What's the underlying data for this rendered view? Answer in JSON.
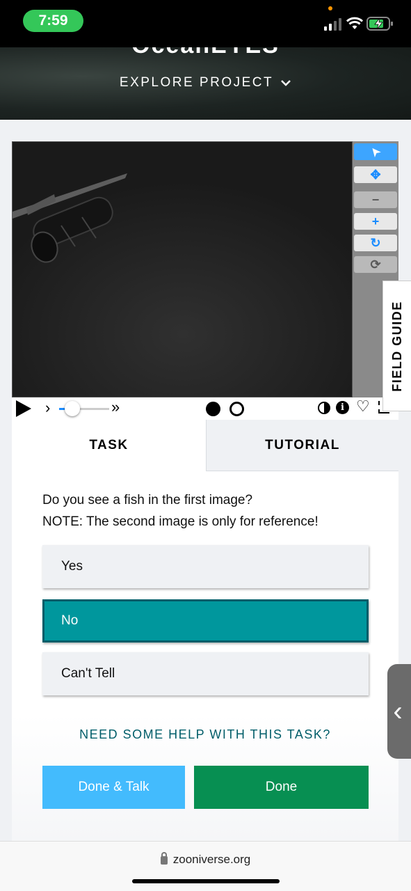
{
  "status_bar": {
    "time": "7:59"
  },
  "hero": {
    "title_partial": "OceanEYES",
    "explore_label": "EXPLORE PROJECT"
  },
  "viewer": {
    "tools": [
      "pointer-icon",
      "move-icon",
      "zoom-out-icon",
      "zoom-in-icon",
      "rotate-icon",
      "reset-icon"
    ],
    "tool_glyphs": {
      "pointer": "➤",
      "move": "✥",
      "zoom_out": "−",
      "zoom_in": "+",
      "rotate": "↻",
      "reset": "⟳"
    },
    "controls": {
      "step_glyph": "›",
      "fast_glyph": "»",
      "info_glyph": "i",
      "heart_glyph": "♡"
    },
    "frame_count": 2,
    "current_frame": 1
  },
  "field_guide": {
    "label": "FIELD GUIDE"
  },
  "task_panel": {
    "tabs": [
      {
        "label": "TASK",
        "active": true
      },
      {
        "label": "TUTORIAL",
        "active": false
      }
    ],
    "question_line1": "Do you see a fish in the first image?",
    "question_line2": "NOTE: The second image is only for reference!",
    "answers": [
      {
        "label": "Yes",
        "selected": false
      },
      {
        "label": "No",
        "selected": true
      },
      {
        "label": "Can't Tell",
        "selected": false
      }
    ],
    "help_link": "NEED SOME HELP WITH THIS TASK?",
    "done_talk_label": "Done & Talk",
    "done_label": "Done"
  },
  "side_handle": {
    "glyph": "‹"
  },
  "browser": {
    "url": "zooniverse.org"
  },
  "colors": {
    "selected_answer": "#00979d",
    "done_talk": "#43bbfd",
    "done": "#078f52",
    "help_link": "#005d69",
    "tool_accent": "#1a8cff"
  }
}
